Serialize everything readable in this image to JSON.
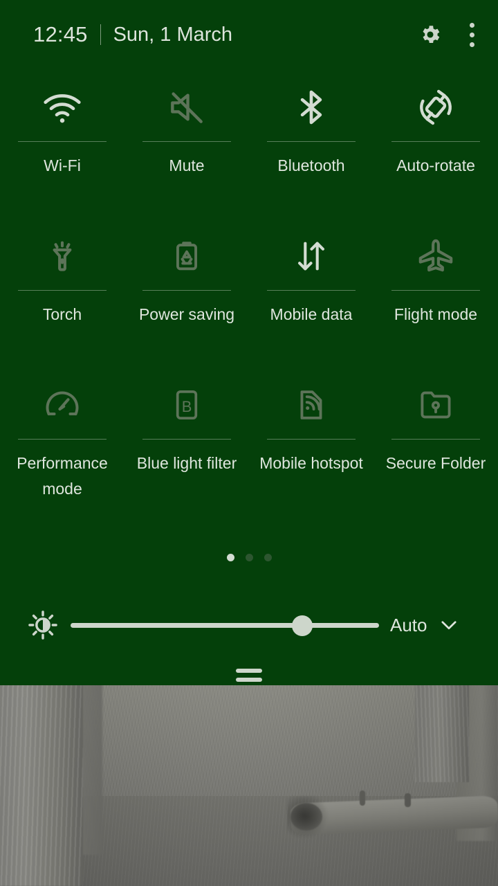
{
  "statusbar": {
    "time": "12:45",
    "separator": "|",
    "date": "Sun, 1 March",
    "settings_icon": "gear-icon",
    "overflow_icon": "three-dot-menu-icon"
  },
  "theme": {
    "panel_bg": "#04400a",
    "icon_active": "#d3dcd2",
    "icon_inactive": "#5d7459",
    "text": "#dfe6de",
    "divider": "#9fb39c"
  },
  "quick_settings": {
    "tiles": [
      {
        "label": "Wi-Fi",
        "icon": "wifi-icon",
        "state": "on"
      },
      {
        "label": "Mute",
        "icon": "volume-mute-icon",
        "state": "off"
      },
      {
        "label": "Bluetooth",
        "icon": "bluetooth-icon",
        "state": "on"
      },
      {
        "label": "Auto-rotate",
        "icon": "auto-rotate-icon",
        "state": "on"
      },
      {
        "label": "Torch",
        "icon": "flashlight-icon",
        "state": "off"
      },
      {
        "label": "Power saving",
        "icon": "battery-saver-icon",
        "state": "off"
      },
      {
        "label": "Mobile data",
        "icon": "data-transfer-icon",
        "state": "on"
      },
      {
        "label": "Flight mode",
        "icon": "airplane-icon",
        "state": "off"
      },
      {
        "label": "Performance mode",
        "icon": "speedometer-icon",
        "state": "off"
      },
      {
        "label": "Blue light filter",
        "icon": "blue-light-filter-icon",
        "state": "off"
      },
      {
        "label": "Mobile hotspot",
        "icon": "hotspot-icon",
        "state": "off"
      },
      {
        "label": "Secure Folder",
        "icon": "secure-folder-icon",
        "state": "off"
      }
    ]
  },
  "pagination": {
    "total": 3,
    "current": 1
  },
  "brightness": {
    "icon": "brightness-icon",
    "value_percent": 75,
    "auto_label": "Auto",
    "chevron_icon": "chevron-down-icon"
  },
  "drag_handle": {
    "name": "panel-drag-handle"
  }
}
